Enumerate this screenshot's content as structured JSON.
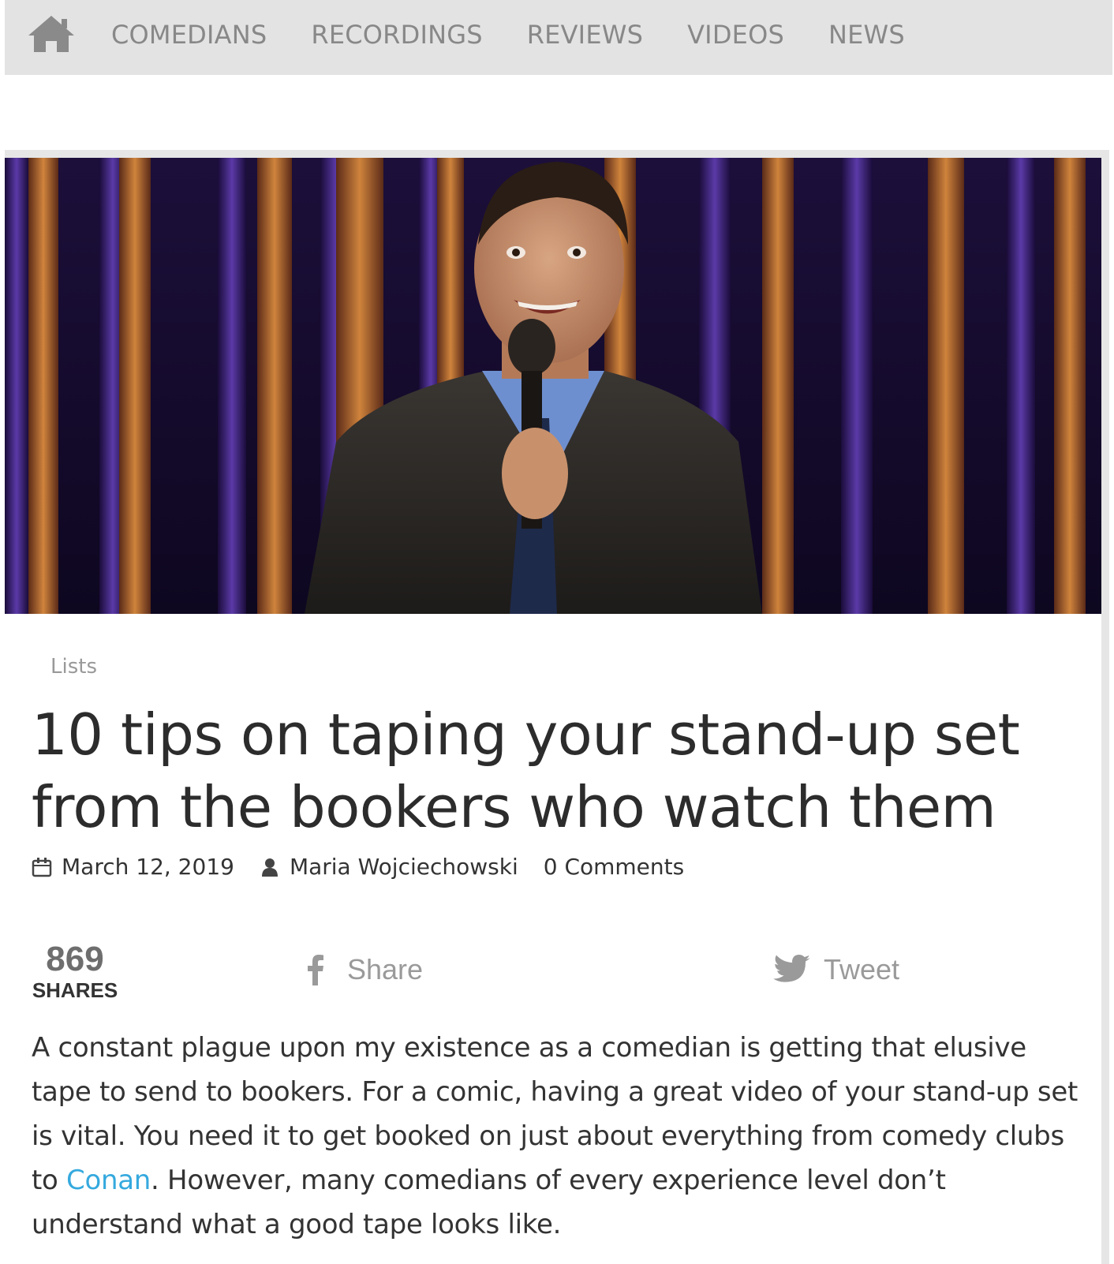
{
  "nav": {
    "home_icon": "home-icon",
    "items": [
      "COMEDIANS",
      "RECORDINGS",
      "REVIEWS",
      "VIDEOS",
      "NEWS"
    ]
  },
  "hero": {
    "image": "comedian-on-stage-photo"
  },
  "article": {
    "category": "Lists",
    "title": "10 tips on taping your stand-up set from the bookers who watch them",
    "date": "March 12, 2019",
    "author": "Maria Wojciechowski",
    "comments": "0 Comments"
  },
  "social": {
    "share_count": "869",
    "share_count_label": "SHARES",
    "share_label": "Share",
    "tweet_label": "Tweet"
  },
  "body": {
    "text_before_link": "A constant plague upon my existence as a comedian is getting that elusive tape to send to bookers. For a comic, having a great video of your stand-up set is vital. You need it to get booked on just about everything from comedy clubs to ",
    "link_text": "Conan",
    "text_after_link": ". However, many comedians of every experience level don’t understand what a good tape looks like."
  },
  "colors": {
    "nav_bg": "#e3e3e3",
    "nav_text": "#888888",
    "link": "#35a9de",
    "text": "#333333"
  }
}
